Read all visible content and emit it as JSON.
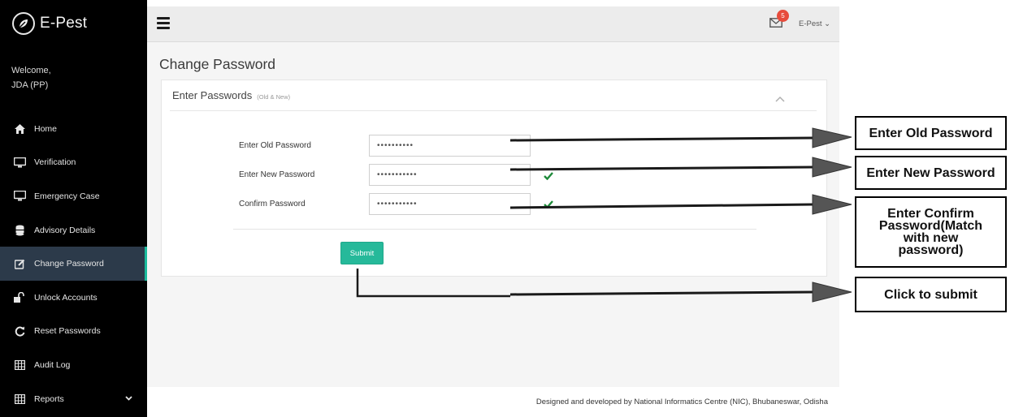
{
  "app": {
    "name": "E-Pest"
  },
  "user": {
    "welcome": "Welcome,",
    "name": "JDA (PP)",
    "menu_label": "E-Pest",
    "notification_count": "5"
  },
  "sidebar": {
    "items": [
      {
        "label": "Home",
        "icon": "home-icon"
      },
      {
        "label": "Verification",
        "icon": "monitor-icon"
      },
      {
        "label": "Emergency Case",
        "icon": "monitor-icon"
      },
      {
        "label": "Advisory Details",
        "icon": "database-icon"
      },
      {
        "label": "Change Password",
        "icon": "edit-icon",
        "active": true
      },
      {
        "label": "Unlock Accounts",
        "icon": "unlock-icon"
      },
      {
        "label": "Reset Passwords",
        "icon": "refresh-icon"
      },
      {
        "label": "Audit Log",
        "icon": "table-icon"
      },
      {
        "label": "Reports",
        "icon": "table-icon",
        "has_submenu": true
      }
    ]
  },
  "page": {
    "title": "Change Password",
    "panel_title": "Enter Passwords",
    "panel_subtitle": "(Old & New)",
    "fields": [
      {
        "label": "Enter Old Password",
        "value": "••••••••••"
      },
      {
        "label": "Enter New Password",
        "value": "•••••••••••"
      },
      {
        "label": "Confirm Password",
        "value": "•••••••••••"
      }
    ],
    "submit_label": "Submit"
  },
  "footer": {
    "text": "Designed and developed by National Informatics Centre (NIC), Bhubaneswar, Odisha"
  },
  "annotations": {
    "old_password": "Enter Old Password",
    "new_password": "Enter New Password",
    "confirm_password": "Enter Confirm Password(Match with new password)",
    "submit": "Click to submit"
  },
  "colors": {
    "sidebar_bg": "#000000",
    "accent": "#26b99a",
    "badge": "#e74c3c",
    "check": "#1e8a3a"
  }
}
